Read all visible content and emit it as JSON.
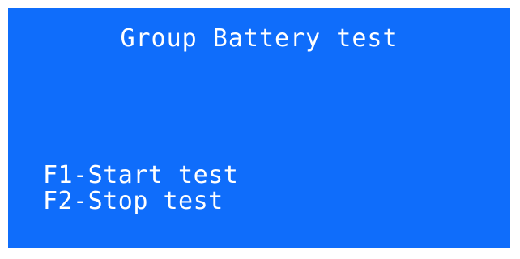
{
  "screen": {
    "title": "Group Battery test",
    "background_color": "#0f6dfb",
    "text_color": "#ffffff"
  },
  "menu": {
    "options": [
      {
        "label": "F1-Start test"
      },
      {
        "label": "F2-Stop test"
      }
    ]
  }
}
